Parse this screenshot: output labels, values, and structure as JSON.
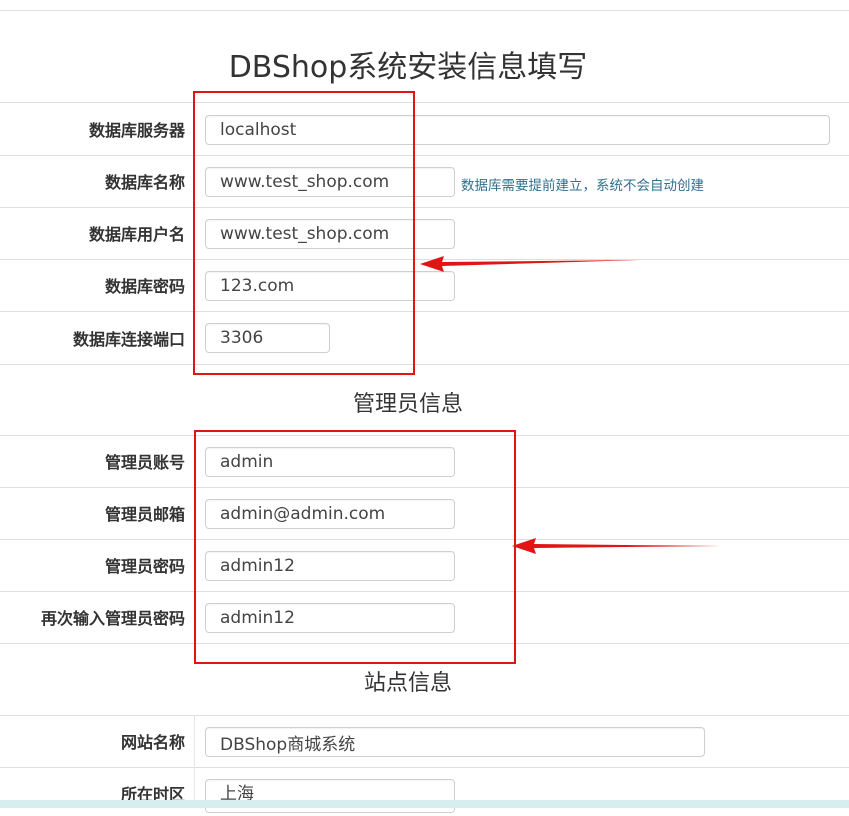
{
  "page": {
    "title": "DBShop系统安装信息填写"
  },
  "database": {
    "server": {
      "label": "数据库服务器",
      "value": "localhost"
    },
    "name": {
      "label": "数据库名称",
      "value": "www.test_shop.com",
      "hint": "数据库需要提前建立，系统不会自动创建"
    },
    "user": {
      "label": "数据库用户名",
      "value": "www.test_shop.com"
    },
    "password": {
      "label": "数据库密码",
      "value": "123.com"
    },
    "port": {
      "label": "数据库连接端口",
      "value": "3306"
    }
  },
  "admin": {
    "section_title": "管理员信息",
    "account": {
      "label": "管理员账号",
      "value": "admin"
    },
    "email": {
      "label": "管理员邮箱",
      "value": "admin@admin.com"
    },
    "password": {
      "label": "管理员密码",
      "value": "admin12"
    },
    "password_confirm": {
      "label": "再次输入管理员密码",
      "value": "admin12"
    }
  },
  "site": {
    "section_title": "站点信息",
    "name": {
      "label": "网站名称",
      "value": "DBShop商城系统"
    },
    "timezone": {
      "label": "所在时区",
      "value": "上海"
    }
  },
  "colors": {
    "annotation": "#e01515",
    "hint": "#31708f"
  }
}
